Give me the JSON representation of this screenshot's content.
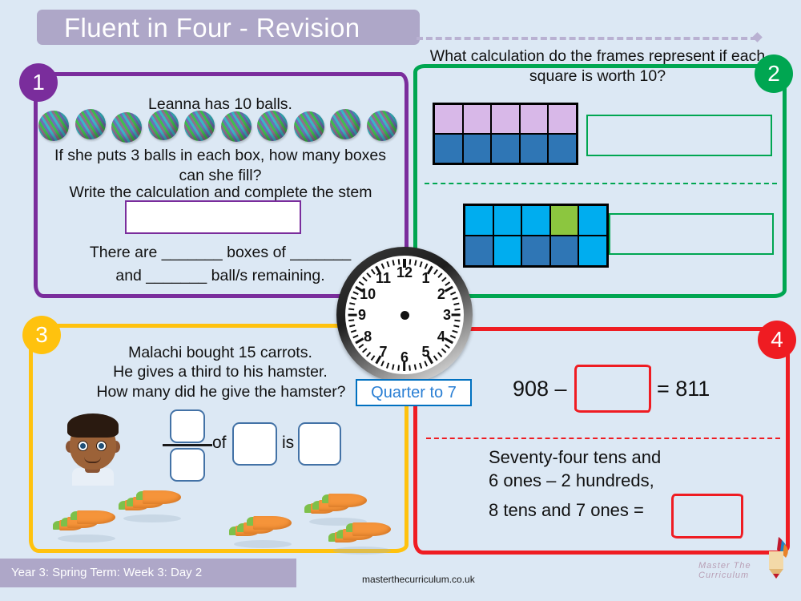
{
  "header": {
    "title": "Fluent in Four - Revision"
  },
  "footer": {
    "term_label": "Year 3: Spring Term: Week 3: Day 2",
    "website": "masterthecurriculum.co.uk",
    "brand": "Master The Curriculum"
  },
  "colors": {
    "background": "#dce8f4",
    "title_bar": "#aea7c8",
    "q1_purple": "#7a2d9c",
    "q2_green": "#00a651",
    "q3_yellow": "#ffc20e",
    "q4_red": "#ef1c22",
    "answer_box_border": "#4372a6",
    "clock_label_blue": "#2a7fd4"
  },
  "questions": [
    {
      "number": "1",
      "accent": "#7a2d9c",
      "lines": [
        "Leanna has 10 balls.",
        "If she puts 3 balls in each box, how many boxes can she fill?",
        "Write the calculation and complete the stem sentence."
      ],
      "line1": "Leanna has 10 balls.",
      "line2": "If she puts 3 balls in each box, how many boxes can she fill?",
      "line3": "Write the calculation and complete the stem sentence.",
      "stem_line1": "There are _______ boxes of _______",
      "stem_line2": "and  _______ ball/s remaining.",
      "ball_count": 10,
      "answer_box_value": ""
    },
    {
      "number": "2",
      "accent": "#00a651",
      "title": "What calculation do the frames represent if each square is worth 10?",
      "frames": [
        {
          "name": "frame-one",
          "square_value": 10,
          "rows": [
            [
              "#d8b8e8",
              "#d8b8e8",
              "#d8b8e8",
              "#d8b8e8",
              "#d8b8e8"
            ],
            [
              "#2f76b5",
              "#2f76b5",
              "#2f76b5",
              "#2f76b5",
              "#2f76b5"
            ]
          ],
          "answer_value": ""
        },
        {
          "name": "frame-two",
          "square_value": 10,
          "rows": [
            [
              "#00adef",
              "#00adef",
              "#00adef",
              "#8cc63f",
              "#00adef"
            ],
            [
              "#2f76b5",
              "#00adef",
              "#2f76b5",
              "#2f76b5",
              "#00adef"
            ]
          ],
          "answer_value": ""
        }
      ]
    },
    {
      "number": "3",
      "accent": "#ffc20e",
      "line1": "Malachi bought 15 carrots.",
      "line2": "He gives a third to his hamster.",
      "line3": "How many did he give the hamster?",
      "fraction_numerator": "",
      "fraction_denominator": "",
      "of_label": "of",
      "of_value": "",
      "is_label": "is",
      "is_value": "",
      "carrot_groups": 5,
      "carrots_per_group": 3,
      "carrot_total": 15
    },
    {
      "number": "4",
      "accent": "#ef1c22",
      "equation_left": "908 –",
      "equation_right": "= 811",
      "equation_box_value": "",
      "text_line1": "Seventy-four tens and",
      "text_line2": "6 ones – 2 hundreds,",
      "text_line3": "8 tens and 7 ones =",
      "text_box_value": ""
    }
  ],
  "clock": {
    "label": "Quarter to 7",
    "numbers": [
      "12",
      "1",
      "2",
      "3",
      "4",
      "5",
      "6",
      "7",
      "8",
      "9",
      "10",
      "11"
    ],
    "hour_hand": null,
    "minute_hand": null
  }
}
